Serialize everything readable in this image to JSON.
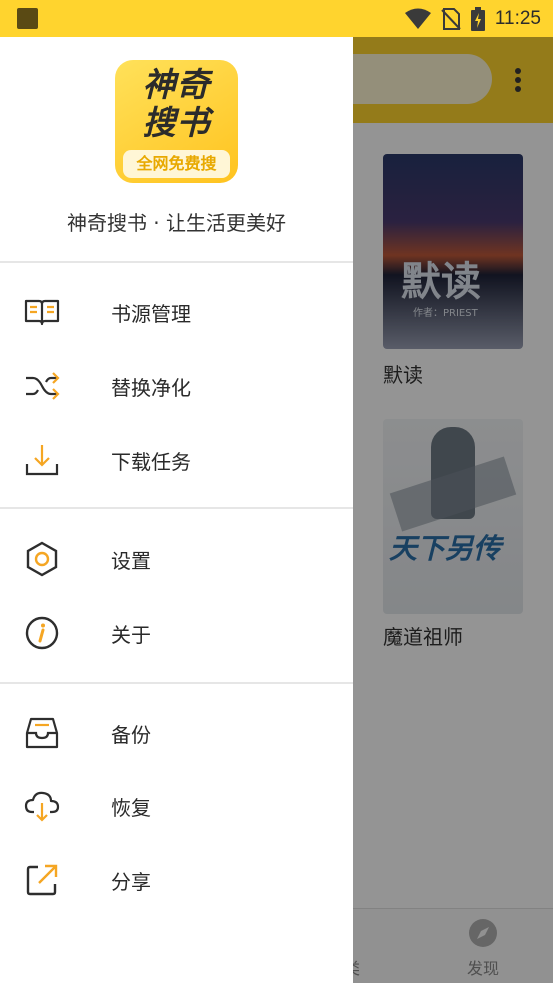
{
  "status_bar": {
    "time": "11:25"
  },
  "drawer": {
    "logo": {
      "line1": "神奇",
      "line2": "搜书",
      "badge": "全网免费搜"
    },
    "tagline": "神奇搜书 · 让生活更美好",
    "sections": [
      [
        {
          "icon": "book-open-icon",
          "label": "书源管理"
        },
        {
          "icon": "shuffle-icon",
          "label": "替换净化"
        },
        {
          "icon": "download-icon",
          "label": "下载任务"
        }
      ],
      [
        {
          "icon": "settings-hexagon-icon",
          "label": "设置"
        },
        {
          "icon": "info-icon",
          "label": "关于"
        }
      ],
      [
        {
          "icon": "inbox-tray-icon",
          "label": "备份"
        },
        {
          "icon": "cloud-download-icon",
          "label": "恢复"
        },
        {
          "icon": "share-icon",
          "label": "分享"
        }
      ]
    ]
  },
  "background": {
    "books": [
      {
        "title": "默读",
        "cover_title": "默读",
        "cover_author": "作者：PRIEST"
      },
      {
        "title": "魔道祖师",
        "cover_title": "天下另传"
      }
    ],
    "bottom_nav": {
      "item_partial": "类",
      "discover": "发现"
    }
  },
  "colors": {
    "accent": "#ffd42e",
    "icon_accent": "#f5a623",
    "icon_dark": "#2e2e2e"
  }
}
